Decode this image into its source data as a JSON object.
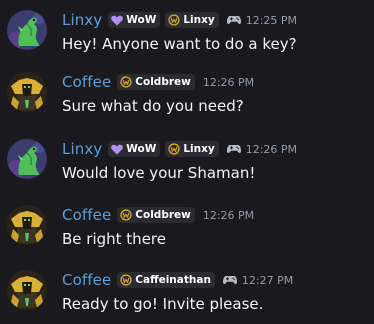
{
  "colors": {
    "background": "#1a1a1e",
    "username": "#5b9fdc",
    "tag_background": "#2b2c31",
    "wow_heart": "#b48ef2",
    "gold_badge": "#d9a92a",
    "timestamp": "#949ba4",
    "message_text": "#f2f3f5"
  },
  "messages": [
    {
      "author": "Linxy",
      "avatar": "green-dragon-avatar",
      "tags": [
        {
          "icon": "heart-icon",
          "label": "WoW"
        },
        {
          "icon": "w-badge-icon",
          "label": "Linxy"
        }
      ],
      "activity_icon": "gamepad-icon",
      "timestamp": "12:25 PM",
      "text": "Hey! Anyone want to do a key?"
    },
    {
      "author": "Coffee",
      "avatar": "gold-armor-avatar",
      "tags": [
        {
          "icon": "w-badge-icon",
          "label": "Coldbrew"
        }
      ],
      "activity_icon": null,
      "timestamp": "12:26 PM",
      "text": "Sure what do you need?"
    },
    {
      "author": "Linxy",
      "avatar": "green-dragon-avatar",
      "tags": [
        {
          "icon": "heart-icon",
          "label": "WoW"
        },
        {
          "icon": "w-badge-icon",
          "label": "Linxy"
        }
      ],
      "activity_icon": "gamepad-icon",
      "timestamp": "12:26 PM",
      "text": "Would love your Shaman!"
    },
    {
      "author": "Coffee",
      "avatar": "gold-armor-avatar",
      "tags": [
        {
          "icon": "w-badge-icon",
          "label": "Coldbrew"
        }
      ],
      "activity_icon": null,
      "timestamp": "12:26 PM",
      "text": "Be right there"
    },
    {
      "author": "Coffee",
      "avatar": "gold-armor-avatar",
      "tags": [
        {
          "icon": "w-badge-icon",
          "label": "Caffeinathan"
        }
      ],
      "activity_icon": "gamepad-icon",
      "timestamp": "12:27 PM",
      "text": "Ready to go! Invite please."
    }
  ]
}
